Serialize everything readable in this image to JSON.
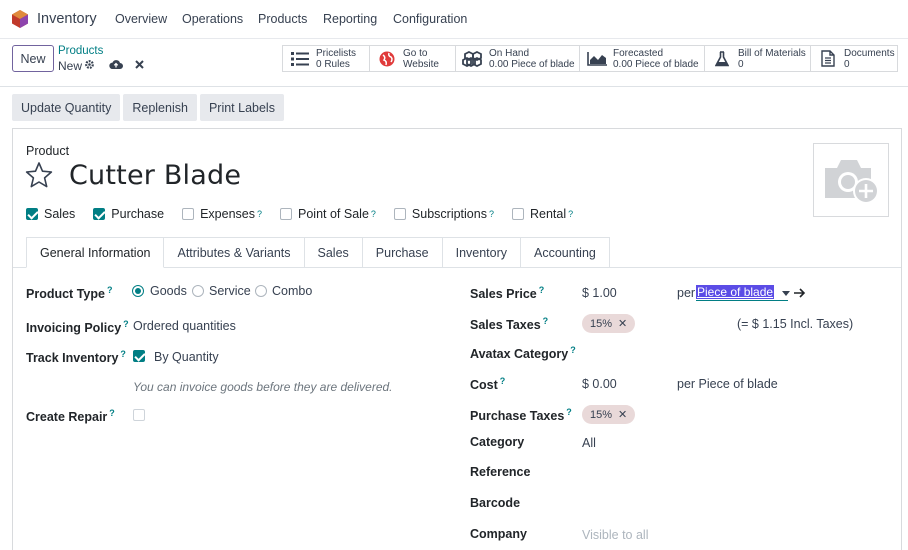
{
  "nav": {
    "app_name": "Inventory",
    "menu": [
      "Overview",
      "Operations",
      "Products",
      "Reporting",
      "Configuration"
    ]
  },
  "control": {
    "new_label": "New",
    "breadcrumb_parent": "Products",
    "breadcrumb_current": "New"
  },
  "smart_buttons": [
    {
      "line1": "Pricelists",
      "line2": "0 Rules",
      "icon": "list-icon"
    },
    {
      "line1": "Go to",
      "line2": "Website",
      "icon": "globe-icon"
    },
    {
      "line1": "On Hand",
      "line2": "0.00 Piece of blade",
      "icon": "cubes-icon"
    },
    {
      "line1": "Forecasted",
      "line2": "0.00 Piece of blade",
      "icon": "area-chart-icon"
    },
    {
      "line1": "Bill of Materials",
      "line2": "0",
      "icon": "flask-icon"
    },
    {
      "line1": "Documents",
      "line2": "0",
      "icon": "document-icon"
    }
  ],
  "actions": [
    "Update Quantity",
    "Replenish",
    "Print Labels"
  ],
  "form": {
    "product_label": "Product",
    "product_name": "Cutter Blade",
    "checkboxes": [
      {
        "label": "Sales",
        "checked": true,
        "help": false
      },
      {
        "label": "Purchase",
        "checked": true,
        "help": false
      },
      {
        "label": "Expenses",
        "checked": false,
        "help": true
      },
      {
        "label": "Point of Sale",
        "checked": false,
        "help": true
      },
      {
        "label": "Subscriptions",
        "checked": false,
        "help": true
      },
      {
        "label": "Rental",
        "checked": false,
        "help": true
      }
    ],
    "help_mark": "?",
    "tabs": [
      "General Information",
      "Attributes & Variants",
      "Sales",
      "Purchase",
      "Inventory",
      "Accounting"
    ],
    "left": {
      "product_type_label": "Product Type",
      "product_type_options": [
        "Goods",
        "Service",
        "Combo"
      ],
      "product_type_selected": "Goods",
      "invoicing_policy_label": "Invoicing Policy",
      "invoicing_policy_value": "Ordered quantities",
      "track_inventory_label": "Track Inventory",
      "track_inventory_value": "By Quantity",
      "track_hint": "You can invoice goods before they are delivered.",
      "create_repair_label": "Create Repair"
    },
    "right": {
      "sales_price_label": "Sales Price",
      "sales_price_value": "$ 1.00",
      "per_label": "per",
      "uom_selected": "Piece of blade",
      "sales_taxes_label": "Sales Taxes",
      "sales_tax_tag": "15%",
      "incl_taxes": "(= $ 1.15 Incl. Taxes)",
      "avatax_label": "Avatax Category",
      "cost_label": "Cost",
      "cost_value": "$ 0.00",
      "cost_per": "per Piece of blade",
      "purchase_taxes_label": "Purchase Taxes",
      "purchase_tax_tag": "15%",
      "category_label": "Category",
      "category_value": "All",
      "reference_label": "Reference",
      "barcode_label": "Barcode",
      "company_label": "Company",
      "company_placeholder": "Visible to all"
    }
  },
  "colors": {
    "accent": "#017e84",
    "brand": "#71639e",
    "selection": "#5b4ce6",
    "tag_bg": "#e9d9d9"
  }
}
